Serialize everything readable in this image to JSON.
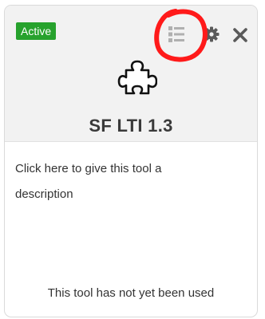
{
  "status_badge": "Active",
  "header_icons": {
    "list": "list-icon",
    "settings": "gear-icon",
    "close": "close-icon",
    "tool": "puzzle-piece-icon"
  },
  "tool_title": "SF LTI 1.3",
  "description_prompt": "Click here to give this tool a description",
  "usage_status": "This tool has not yet been used",
  "colors": {
    "badge_background": "#27a22d",
    "header_background": "#f2f2f2",
    "annotation": "#ff1a1a",
    "icon_gray": "#b0b0b0",
    "icon_dark": "#5a5a5a"
  }
}
